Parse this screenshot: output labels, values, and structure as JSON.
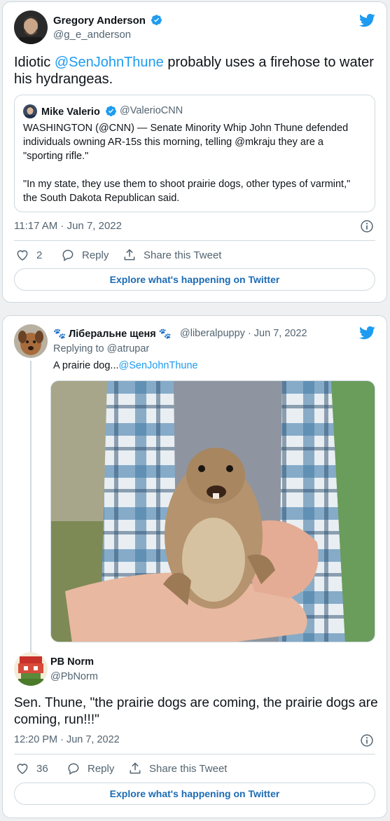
{
  "tweet1": {
    "author_name": "Gregory Anderson",
    "author_handle": "@g_e_anderson",
    "text_before": "Idiotic ",
    "mention": "@SenJohnThune",
    "text_after": " probably uses a firehose to water his hydrangeas.",
    "quote": {
      "author_name": "Mike Valerio",
      "author_handle": "@ValerioCNN",
      "paragraph1": "WASHINGTON (@CNN) — Senate Minority Whip John Thune defended individuals owning AR-15s this morning, telling @mkraju they are a \"sporting rifle.\"",
      "paragraph2": "\"In my state, they use them to shoot prairie dogs, other types of varmint,\" the South Dakota Republican said."
    },
    "timestamp": "11:17 AM · Jun 7, 2022",
    "likes": "2",
    "reply_label": "Reply",
    "share_label": "Share this Tweet",
    "explore_label": "Explore what's happening on Twitter"
  },
  "tweet2": {
    "parent": {
      "author_name": "Ліберальне щеня",
      "paw_emoji": "🐾",
      "author_handle": "@liberalpuppy",
      "date": "· Jun 7, 2022",
      "replying_to_label": "Replying to ",
      "replying_to_handle": "@atrupar",
      "text": "A prairie dog...",
      "mention": "@SenJohnThune"
    },
    "author_name": "PB Norm",
    "author_handle": "@PbNorm",
    "text": "Sen. Thune, \"the prairie dogs are coming, the prairie dogs are coming, run!!!\"",
    "timestamp": "12:20 PM · Jun 7, 2022",
    "likes": "36",
    "reply_label": "Reply",
    "share_label": "Share this Tweet",
    "explore_label": "Explore what's happening on Twitter"
  },
  "icons": {
    "twitter_logo": "twitter-bird-icon",
    "verified": "verified-badge-icon",
    "like": "heart-icon",
    "reply": "speech-bubble-icon",
    "share": "share-upload-icon",
    "info": "info-icon"
  },
  "colors": {
    "twitter_blue": "#1d9bf0",
    "explore_text": "#1b6bb5",
    "muted_text": "#536471"
  }
}
